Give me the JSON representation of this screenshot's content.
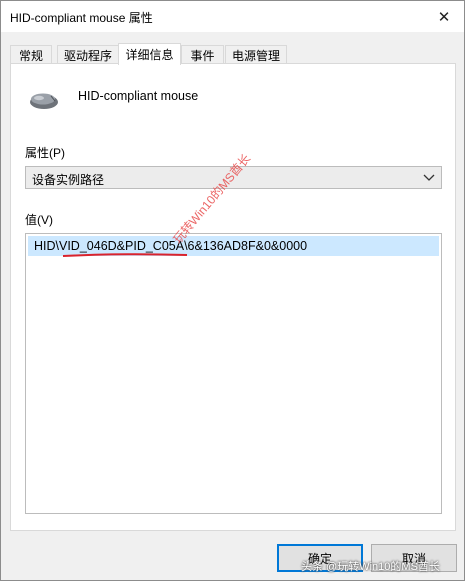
{
  "window": {
    "title": "HID-compliant mouse 属性",
    "close_glyph": "✕"
  },
  "tabs": [
    {
      "label": "常规"
    },
    {
      "label": "驱动程序"
    },
    {
      "label": "详细信息"
    },
    {
      "label": "事件"
    },
    {
      "label": "电源管理"
    }
  ],
  "active_tab": "详细信息",
  "device": {
    "name": "HID-compliant mouse",
    "icon": "mouse-icon"
  },
  "property": {
    "label": "属性(P)",
    "selected": "设备实例路径"
  },
  "value": {
    "label": "值(V)",
    "items": [
      "HID\\VID_046D&PID_C05A\\6&136AD8F&0&0000"
    ]
  },
  "watermark": {
    "text": "玩转Win10的MS酋长",
    "footer": "头条 @玩转Win10的MS酋长"
  },
  "buttons": {
    "ok": "确定",
    "cancel": "取消"
  },
  "colors": {
    "selection": "#cce8ff",
    "accent": "#0078d7",
    "annotation": "#d9232d"
  }
}
